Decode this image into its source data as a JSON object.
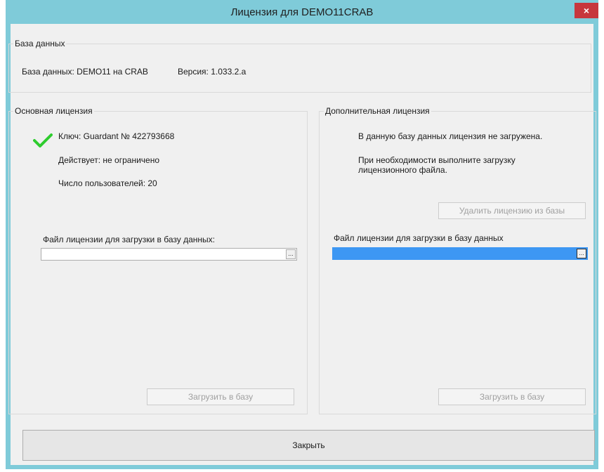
{
  "window": {
    "title": "Лицензия для DEMO11CRAB",
    "close_label": "×"
  },
  "database": {
    "legend": "База данных",
    "info_label": "База данных:",
    "info_value": "DEMO11 на CRAB",
    "version_label": "Версия:",
    "version_value": "1.033.2.a"
  },
  "main_license": {
    "legend": "Основная лицензия",
    "status_icon": "check-icon",
    "status_color": "#2ecc2e",
    "key": "Ключ: Guardant № 422793668",
    "valid": "Действует: не ограничено",
    "users": "Число пользователей: 20",
    "file_label": "Файл лицензии для загрузки в базу данных:",
    "file_value": "",
    "browse_label": "...",
    "load_button": "Загрузить в базу"
  },
  "extra_license": {
    "legend": "Дополнительная лицензия",
    "not_loaded": "В данную базу данных лицензия не загружена.",
    "hint": "При необходимости выполните загрузку лицензионного файла.",
    "delete_button": "Удалить лицензию из базы",
    "file_label": "Файл лицензии для загрузки в базу данных",
    "file_value": "",
    "browse_label": "...",
    "load_button": "Загрузить в базу"
  },
  "footer": {
    "close_button": "Закрыть"
  }
}
